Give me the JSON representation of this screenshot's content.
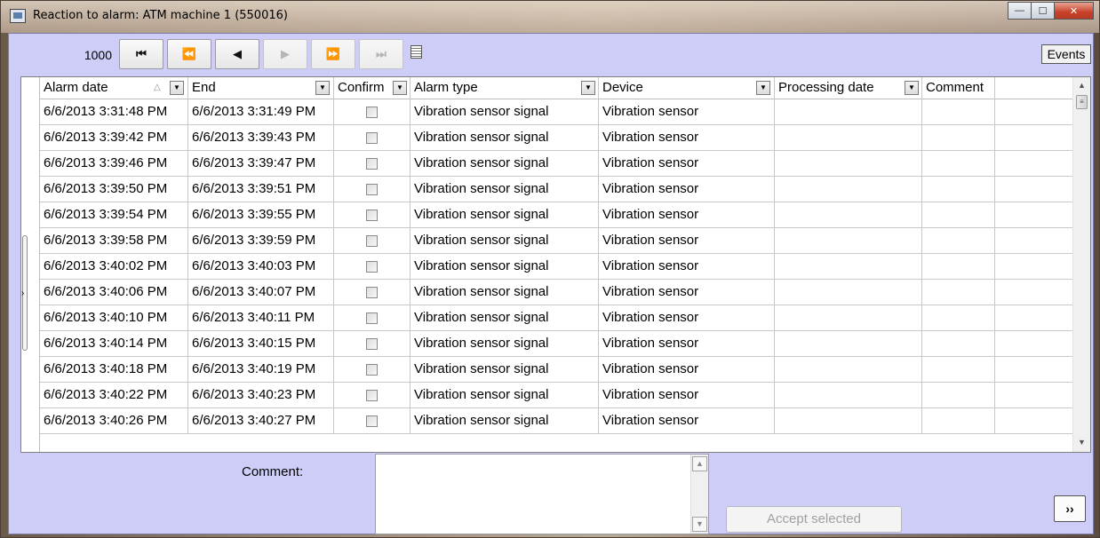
{
  "window": {
    "title": "Reaction to alarm: ATM machine 1 (550016)",
    "controls": {
      "minimize": "—",
      "maximize": "☐",
      "close": "✕"
    }
  },
  "toolbar": {
    "record_count": "1000",
    "nav": {
      "first": "⏮",
      "prev_page": "⏪",
      "prev": "◀",
      "next": "▶",
      "next_page": "⏩",
      "last": "⏭"
    },
    "events_label": "Events"
  },
  "table": {
    "columns": [
      {
        "key": "alarm_date",
        "label": "Alarm date"
      },
      {
        "key": "end",
        "label": "End"
      },
      {
        "key": "confirm",
        "label": "Confirm"
      },
      {
        "key": "alarm_type",
        "label": "Alarm type"
      },
      {
        "key": "device",
        "label": "Device"
      },
      {
        "key": "processing_date",
        "label": "Processing date"
      },
      {
        "key": "comment",
        "label": "Comment"
      }
    ],
    "sort_indicator": "△",
    "dropdown_glyph": "▼",
    "rows": [
      {
        "alarm_date": "6/6/2013 3:31:48 PM",
        "end": "6/6/2013 3:31:49 PM",
        "alarm_type": "Vibration sensor signal",
        "device": "Vibration sensor"
      },
      {
        "alarm_date": "6/6/2013 3:39:42 PM",
        "end": "6/6/2013 3:39:43 PM",
        "alarm_type": "Vibration sensor signal",
        "device": "Vibration sensor"
      },
      {
        "alarm_date": "6/6/2013 3:39:46 PM",
        "end": "6/6/2013 3:39:47 PM",
        "alarm_type": "Vibration sensor signal",
        "device": "Vibration sensor"
      },
      {
        "alarm_date": "6/6/2013 3:39:50 PM",
        "end": "6/6/2013 3:39:51 PM",
        "alarm_type": "Vibration sensor signal",
        "device": "Vibration sensor"
      },
      {
        "alarm_date": "6/6/2013 3:39:54 PM",
        "end": "6/6/2013 3:39:55 PM",
        "alarm_type": "Vibration sensor signal",
        "device": "Vibration sensor"
      },
      {
        "alarm_date": "6/6/2013 3:39:58 PM",
        "end": "6/6/2013 3:39:59 PM",
        "alarm_type": "Vibration sensor signal",
        "device": "Vibration sensor"
      },
      {
        "alarm_date": "6/6/2013 3:40:02 PM",
        "end": "6/6/2013 3:40:03 PM",
        "alarm_type": "Vibration sensor signal",
        "device": "Vibration sensor"
      },
      {
        "alarm_date": "6/6/2013 3:40:06 PM",
        "end": "6/6/2013 3:40:07 PM",
        "alarm_type": "Vibration sensor signal",
        "device": "Vibration sensor"
      },
      {
        "alarm_date": "6/6/2013 3:40:10 PM",
        "end": "6/6/2013 3:40:11 PM",
        "alarm_type": "Vibration sensor signal",
        "device": "Vibration sensor"
      },
      {
        "alarm_date": "6/6/2013 3:40:14 PM",
        "end": "6/6/2013 3:40:15 PM",
        "alarm_type": "Vibration sensor signal",
        "device": "Vibration sensor"
      },
      {
        "alarm_date": "6/6/2013 3:40:18 PM",
        "end": "6/6/2013 3:40:19 PM",
        "alarm_type": "Vibration sensor signal",
        "device": "Vibration sensor"
      },
      {
        "alarm_date": "6/6/2013 3:40:22 PM",
        "end": "6/6/2013 3:40:23 PM",
        "alarm_type": "Vibration sensor signal",
        "device": "Vibration sensor"
      },
      {
        "alarm_date": "6/6/2013 3:40:26 PM",
        "end": "6/6/2013 3:40:27 PM",
        "alarm_type": "Vibration sensor signal",
        "device": "Vibration sensor"
      }
    ]
  },
  "bottom": {
    "comment_label": "Comment:",
    "comment_value": "",
    "accept_label": "Accept selected",
    "next_label": "››"
  },
  "colors": {
    "client_bg": "#cdcdf7",
    "grid_line": "#c8c8c8",
    "close_button": "#c7412a"
  }
}
